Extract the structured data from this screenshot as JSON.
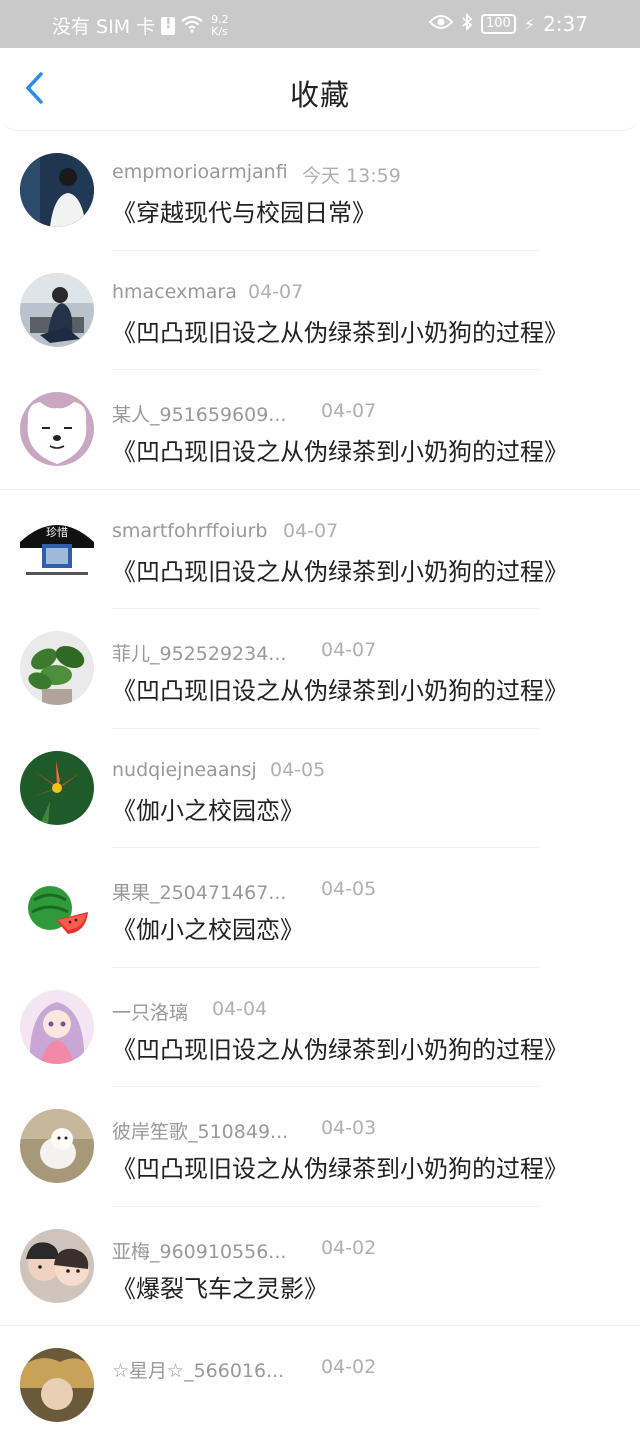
{
  "status_bar": {
    "carrier": "没有 SIM 卡",
    "speed_value": "9.2",
    "speed_unit": "K/s",
    "battery": "100",
    "time": "2:37"
  },
  "header": {
    "title": "收藏"
  },
  "items": [
    {
      "name": "empmorioarmjanfi",
      "time": "今天 13:59",
      "title": "《穿越现代与校园日常》"
    },
    {
      "name": "hmacexmara",
      "time": "04-07",
      "title": "《凹凸现旧设之从伪绿茶到小奶狗的过程》"
    },
    {
      "name": "某人_951659609...",
      "time": "04-07",
      "title": "《凹凸现旧设之从伪绿茶到小奶狗的过程》"
    },
    {
      "name": "smartfohrffoiurb",
      "time": "04-07",
      "title": "《凹凸现旧设之从伪绿茶到小奶狗的过程》",
      "avatar_text": "珍惜"
    },
    {
      "name": "菲儿_952529234...",
      "time": "04-07",
      "title": "《凹凸现旧设之从伪绿茶到小奶狗的过程》"
    },
    {
      "name": "nudqiejneaansj",
      "time": "04-05",
      "title": "《伽小之校园恋》"
    },
    {
      "name": "果果_250471467...",
      "time": "04-05",
      "title": "《伽小之校园恋》"
    },
    {
      "name": "一只洛璃",
      "time": "04-04",
      "title": "《凹凸现旧设之从伪绿茶到小奶狗的过程》"
    },
    {
      "name": "彼岸笙歌_510849...",
      "time": "04-03",
      "title": "《凹凸现旧设之从伪绿茶到小奶狗的过程》"
    },
    {
      "name": "亚梅_960910556...",
      "time": "04-02",
      "title": "《爆裂飞车之灵影》"
    },
    {
      "name": "☆星月☆_566016...",
      "time": "04-02",
      "title": ""
    }
  ],
  "colors": {
    "accent": "#2b8ee8",
    "status_bar_bg": "#c9c9c9"
  }
}
